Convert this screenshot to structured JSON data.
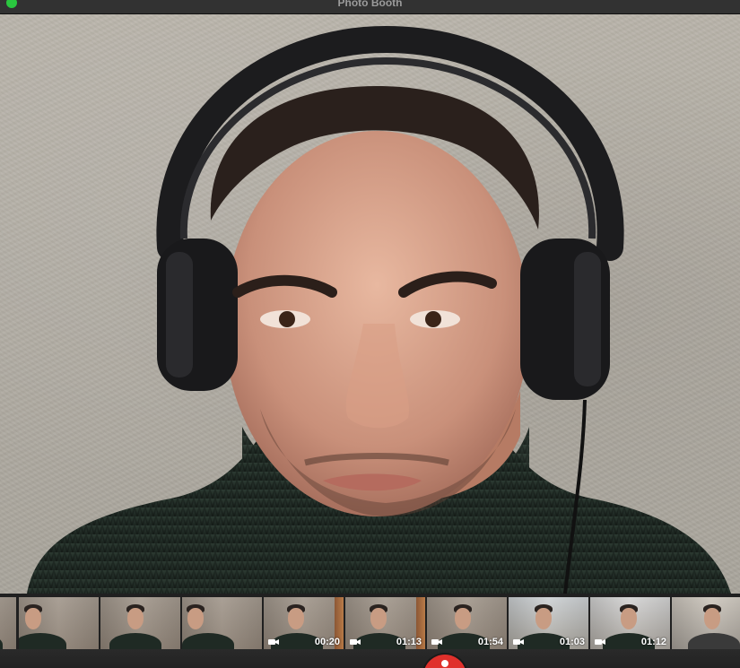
{
  "window": {
    "title": "Photo Booth"
  },
  "preview": {
    "description_icon": "live-camera-view"
  },
  "thumbnails": [
    {
      "type": "photo",
      "duration": ""
    },
    {
      "type": "photo",
      "duration": ""
    },
    {
      "type": "photo",
      "duration": ""
    },
    {
      "type": "photo",
      "duration": ""
    },
    {
      "type": "video",
      "duration": "00:20"
    },
    {
      "type": "video",
      "duration": "01:13"
    },
    {
      "type": "video",
      "duration": "01:54"
    },
    {
      "type": "video",
      "duration": "01:03"
    },
    {
      "type": "video",
      "duration": "01:12"
    },
    {
      "type": "photo",
      "duration": ""
    }
  ],
  "colors": {
    "shutter": "#e0302b",
    "traffic_green": "#2ac73f",
    "titlebar": "#323232"
  }
}
